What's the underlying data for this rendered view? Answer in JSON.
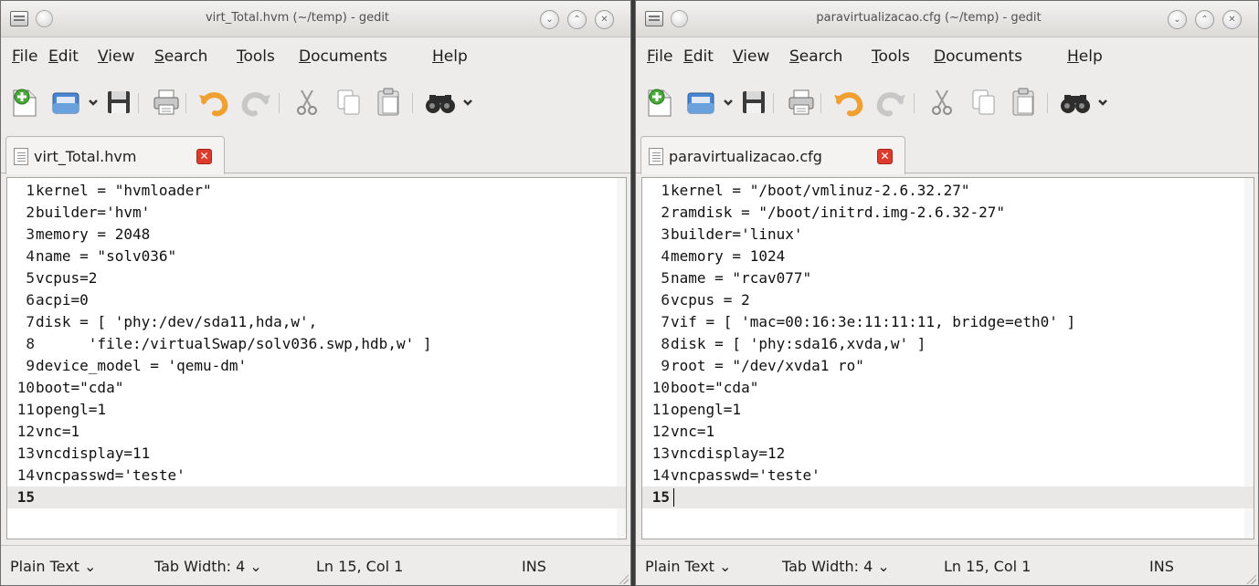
{
  "windows": [
    {
      "title": "virt_Total.hvm (~/temp) - gedit",
      "menu": [
        "File",
        "Edit",
        "View",
        "Search",
        "Tools",
        "Documents",
        "Help"
      ],
      "tab_label": "virt_Total.hvm",
      "lines": [
        {
          "n": "1",
          "text": "kernel = \"hvmloader\""
        },
        {
          "n": "2",
          "text": "builder='hvm'"
        },
        {
          "n": "3",
          "text": "memory = 2048"
        },
        {
          "n": "4",
          "text": "name = \"solv036\""
        },
        {
          "n": "5",
          "text": "vcpus=2"
        },
        {
          "n": "6",
          "text": "acpi=0"
        },
        {
          "n": "7",
          "text": "disk = [ 'phy:/dev/sda11,hda,w',"
        },
        {
          "n": "8",
          "text": "      'file:/virtualSwap/solv036.swp,hdb,w' ]"
        },
        {
          "n": "9",
          "text": "device_model = 'qemu-dm'"
        },
        {
          "n": "10",
          "text": "boot=\"cda\""
        },
        {
          "n": "11",
          "text": "opengl=1"
        },
        {
          "n": "12",
          "text": "vnc=1"
        },
        {
          "n": "13",
          "text": "vncdisplay=11"
        },
        {
          "n": "14",
          "text": "vncpasswd='teste'"
        },
        {
          "n": "15",
          "text": ""
        }
      ],
      "status": {
        "language": "Plain Text",
        "tab_width": "Tab Width: 4",
        "position": "Ln 15, Col 1",
        "mode": "INS"
      }
    },
    {
      "title": "paravirtualizacao.cfg (~/temp) - gedit",
      "menu": [
        "File",
        "Edit",
        "View",
        "Search",
        "Tools",
        "Documents",
        "Help"
      ],
      "tab_label": "paravirtualizacao.cfg",
      "lines": [
        {
          "n": "1",
          "text": "kernel = \"/boot/vmlinuz-2.6.32.27\""
        },
        {
          "n": "2",
          "text": "ramdisk = \"/boot/initrd.img-2.6.32-27\""
        },
        {
          "n": "3",
          "text": "builder='linux'"
        },
        {
          "n": "4",
          "text": "memory = 1024"
        },
        {
          "n": "5",
          "text": "name = \"rcav077\""
        },
        {
          "n": "6",
          "text": "vcpus = 2"
        },
        {
          "n": "7",
          "text": "vif = [ 'mac=00:16:3e:11:11:11, bridge=eth0' ]"
        },
        {
          "n": "8",
          "text": "disk = [ 'phy:sda16,xvda,w' ]"
        },
        {
          "n": "9",
          "text": "root = \"/dev/xvda1 ro\""
        },
        {
          "n": "10",
          "text": "boot=\"cda\""
        },
        {
          "n": "11",
          "text": "opengl=1"
        },
        {
          "n": "12",
          "text": "vnc=1"
        },
        {
          "n": "13",
          "text": "vncdisplay=12"
        },
        {
          "n": "14",
          "text": "vncpasswd='teste'"
        },
        {
          "n": "15",
          "text": ""
        }
      ],
      "status": {
        "language": "Plain Text",
        "tab_width": "Tab Width: 4",
        "position": "Ln 15, Col 1",
        "mode": "INS"
      }
    }
  ],
  "icons": {
    "new": "new-document-icon",
    "open": "open-folder-icon",
    "save": "save-icon",
    "print": "print-icon",
    "undo": "undo-icon",
    "redo": "redo-icon",
    "cut": "cut-icon",
    "copy": "copy-icon",
    "paste": "paste-icon",
    "find": "binoculars-icon",
    "dropdown": "chevron-down-icon",
    "close_tab": "close-tab-icon"
  },
  "colors": {
    "close_red": "#dd3b2c",
    "current_line": "#e9e8e7",
    "undo_orange": "#f0a030",
    "new_green": "#4aa83a"
  }
}
